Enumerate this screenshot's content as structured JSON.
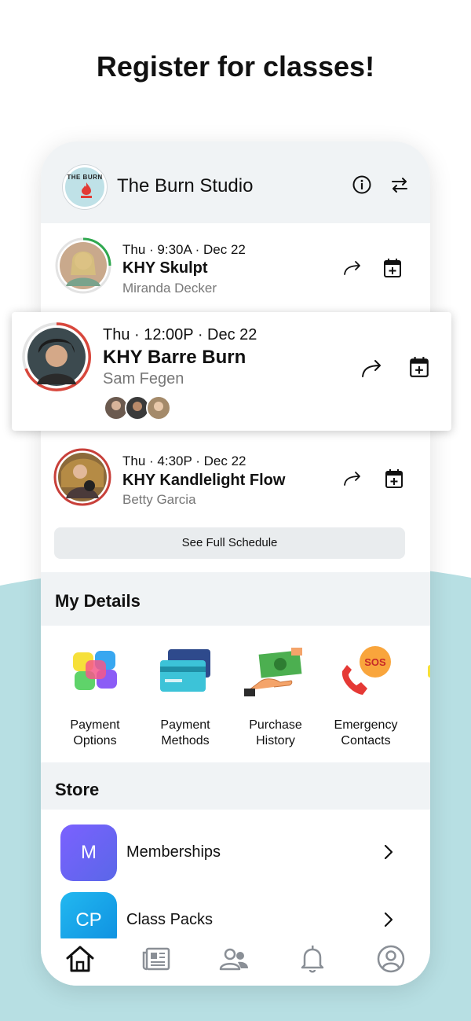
{
  "headline": "Register for classes!",
  "studio": {
    "name": "The Burn Studio",
    "logo_text": "THE BURN",
    "info_icon": "info-icon",
    "switch_icon": "switch-icon"
  },
  "classes": [
    {
      "meta": "Thu · 9:30A · Dec 22",
      "name": "KHY Skulpt",
      "instructor": "Miranda Decker",
      "ring_color": "#2fa84f"
    },
    {
      "meta": "Thu · 12:00P · Dec 22",
      "name": "KHY Barre Burn",
      "instructor": "Sam Fegen",
      "ring_color": "#d8473c"
    },
    {
      "meta": "Thu · 4:30P · Dec 22",
      "name": "KHY Kandlelight Flow",
      "instructor": "Betty Garcia",
      "ring_color": "#c8403a"
    }
  ],
  "see_full_schedule": "See Full Schedule",
  "my_details": {
    "title": "My Details",
    "items": [
      {
        "label_1": "Payment",
        "label_2": "Options",
        "icon": "payment-options-icon"
      },
      {
        "label_1": "Payment",
        "label_2": "Methods",
        "icon": "credit-cards-icon"
      },
      {
        "label_1": "Purchase",
        "label_2": "History",
        "icon": "cash-hand-icon"
      },
      {
        "label_1": "Emergency",
        "label_2": "Contacts",
        "icon": "sos-phone-icon"
      }
    ]
  },
  "store": {
    "title": "Store",
    "items": [
      {
        "badge": "M",
        "label": "Memberships",
        "color": "#6d5ce8"
      },
      {
        "badge": "CP",
        "label": "Class Packs",
        "color": "#1aa3e8"
      }
    ]
  },
  "tabs": [
    "home-icon",
    "news-icon",
    "people-icon",
    "bell-icon",
    "account-icon"
  ],
  "colors": {
    "accent_teal": "#b7dfe3",
    "panel": "#f0f3f5"
  }
}
